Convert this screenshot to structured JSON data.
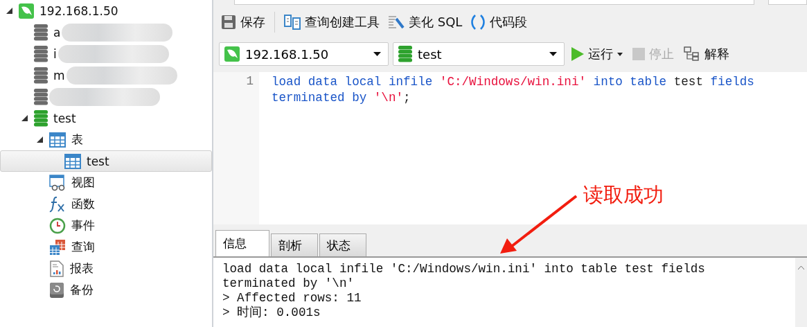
{
  "tree": [
    {
      "kind": "connection",
      "label": "192.168.1.50",
      "expanded": true,
      "selected": false,
      "children": [
        {
          "kind": "database",
          "label": "a",
          "redacted": true,
          "selected": false
        },
        {
          "kind": "database",
          "label": "i",
          "redacted": true,
          "selected": false
        },
        {
          "kind": "database",
          "label": "m",
          "redacted": true,
          "selected": false
        },
        {
          "kind": "database",
          "redacted": true,
          "selected": false
        },
        {
          "kind": "database-open",
          "label": "test",
          "expanded": true,
          "selected": false,
          "children": [
            {
              "kind": "tables",
              "label": "表",
              "expanded": true,
              "selected": false,
              "children": [
                {
                  "kind": "table",
                  "label": "test",
                  "selected": true
                }
              ]
            },
            {
              "kind": "views",
              "label": "视图",
              "selected": false
            },
            {
              "kind": "functions",
              "label": "函数",
              "selected": false
            },
            {
              "kind": "events",
              "label": "事件",
              "selected": false
            },
            {
              "kind": "queries",
              "label": "查询",
              "selected": false
            },
            {
              "kind": "reports",
              "label": "报表",
              "selected": false
            },
            {
              "kind": "backups",
              "label": "备份",
              "selected": false
            }
          ]
        }
      ]
    }
  ],
  "toolbar": [
    {
      "kind": "save",
      "label": "保存"
    },
    {
      "kind": "builder",
      "label": "查询创建工具"
    },
    {
      "kind": "beautify",
      "label": "美化 SQL"
    },
    {
      "kind": "snippet",
      "label": "代码段"
    }
  ],
  "connection_select": {
    "value": "192.168.1.50"
  },
  "database_select": {
    "value": "test"
  },
  "actions": [
    {
      "kind": "run",
      "label": "运行",
      "disabled": false
    },
    {
      "kind": "stop",
      "label": "停止",
      "disabled": true
    },
    {
      "kind": "explain",
      "label": "解释",
      "disabled": false
    }
  ],
  "editor": {
    "line_numbers": [
      "1"
    ],
    "tokens": [
      {
        "kind": "keyword",
        "text": "load data local infile "
      },
      {
        "kind": "string",
        "text": "'C:/Windows/win.ini'"
      },
      {
        "kind": "keyword",
        "text": " into table "
      },
      {
        "kind": "plain",
        "text": "test "
      },
      {
        "kind": "keyword",
        "text": "fields terminated by "
      },
      {
        "kind": "string",
        "text": "'\\n'"
      },
      {
        "kind": "plain",
        "text": ";"
      }
    ]
  },
  "result_tabs": [
    {
      "label": "信息",
      "selected": true
    },
    {
      "label": "剖析",
      "selected": false
    },
    {
      "label": "状态",
      "selected": false
    }
  ],
  "messages": [
    "load data local infile 'C:/Windows/win.ini' into table test fields",
    "terminated by '\\n'",
    "> Affected rows: 11",
    "> 时间: 0.001s"
  ],
  "annotation": {
    "text": "读取成功"
  }
}
